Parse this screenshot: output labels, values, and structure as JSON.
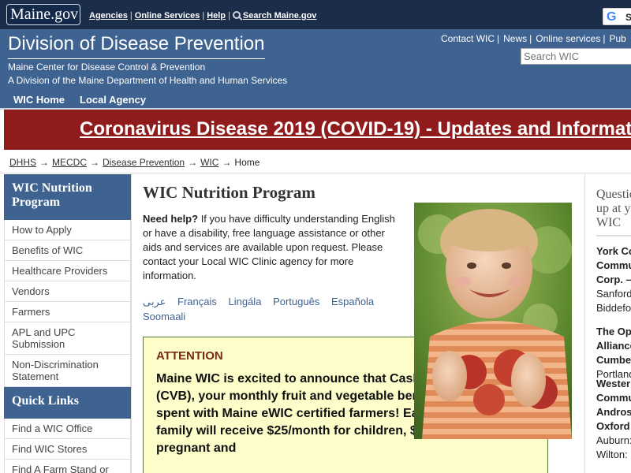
{
  "topbar": {
    "logo_text": "Maine.gov",
    "links": [
      "Agencies",
      "Online Services",
      "Help"
    ],
    "search_link": "Search Maine.gov",
    "translate_label": "S"
  },
  "header": {
    "title": "Division of Disease Prevention",
    "subtitle1": "Maine Center for Disease Control & Prevention",
    "subtitle2": "A Division of the Maine Department of Health and Human Services",
    "links": [
      "Contact WIC",
      "News",
      "Online services",
      "Pub"
    ],
    "search_placeholder": "Search WIC",
    "nav": [
      "WIC Home",
      "Local Agency"
    ]
  },
  "banner": {
    "text": "Coronavirus Disease 2019 (COVID-19) - Updates and Informat"
  },
  "breadcrumb": {
    "items": [
      "DHHS",
      "MECDC",
      "Disease Prevention",
      "WIC"
    ],
    "current": "Home"
  },
  "sidebar": {
    "section1_title": "WIC Nutrition Program",
    "section1_items": [
      "How to Apply",
      "Benefits of WIC",
      "Healthcare Providers",
      "Vendors",
      "Farmers",
      "APL and UPC Submission",
      "Non-Discrimination Statement"
    ],
    "section2_title": "Quick Links",
    "section2_items": [
      "Find a WIC Office",
      "Find WIC Stores",
      "Find A Farm Stand or"
    ]
  },
  "main": {
    "title": "WIC Nutrition Program",
    "help_label": "Need help?",
    "help_text": " If you have difficulty understanding English or have a disability, free language assistance or other aids and services are available upon request. Please contact your Local WIC Clinic agency for more information.",
    "languages": [
      "عربى",
      "Français",
      "Lingála",
      "Português",
      "Española",
      "Soomaali"
    ],
    "attention_title": "ATTENTION",
    "attention_text": "Maine WIC is excited to announce that Cash Value Benefit (CVB), your monthly fruit and vegetable benefit, can now be spent with Maine eWIC certified farmers! Each month, your family will receive $25/month for children, $44/month for pregnant and"
  },
  "rightcol": {
    "title": "Questions? Sign up at your local WIC",
    "agencies": [
      {
        "name": "York County Community Action Corp. – York County",
        "cities": "Sanford\nBiddeford"
      },
      {
        "name": "The Opportunity Alliance – Cumberland",
        "cities": "Portland"
      },
      {
        "name": "Western Maine Community Action – Androscoggin and Oxford",
        "cities": "Auburn:\nWilton:"
      }
    ]
  }
}
